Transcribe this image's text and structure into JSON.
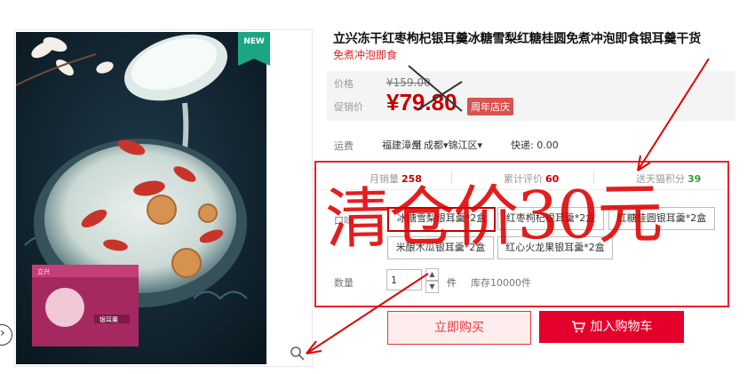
{
  "gallery": {
    "new_badge": "NEW",
    "package_text": "银耳羹",
    "package_brand": "立兴"
  },
  "product": {
    "title": "立兴冻干红枣枸杞银耳羹冰糖雪梨红糖桂圆免煮冲泡即食银耳羹干货",
    "subtitle": "免煮冲泡即食"
  },
  "price": {
    "original_label": "价格",
    "original_value": "¥159.00",
    "promo_label": "促销价",
    "promo_value": "¥79.80",
    "promo_tag": "周年店庆"
  },
  "shipping": {
    "label": "运费",
    "from": "福建漳州",
    "to_word": "至",
    "destination": "成都▾锦江区▾",
    "fee": "快递: 0.00"
  },
  "stats": {
    "sales_label": "月销量",
    "sales_value": "258",
    "reviews_label": "累计评价",
    "reviews_value": "60",
    "points_label": "送天猫积分",
    "points_value": "39"
  },
  "sku": {
    "label": "口味",
    "options": [
      "冰糖雪梨银耳羹*2盒",
      "红枣枸杞银耳羹*2盒",
      "红糖桂圆银耳羹*2盒",
      "米酿木瓜银耳羹*2盒",
      "红心火龙果银耳羹*2盒"
    ],
    "selected_index": 0
  },
  "quantity": {
    "label": "数量",
    "value": "1",
    "unit": "件",
    "stock": "库存10000件"
  },
  "actions": {
    "buy_now": "立即购买",
    "add_to_cart": "加入购物车"
  },
  "annotation": {
    "text": "清仓价30元",
    "color": "#e00000"
  },
  "colors": {
    "price_red": "#c40000",
    "cart_red": "#e4002b",
    "new_badge": "#1ba784"
  }
}
